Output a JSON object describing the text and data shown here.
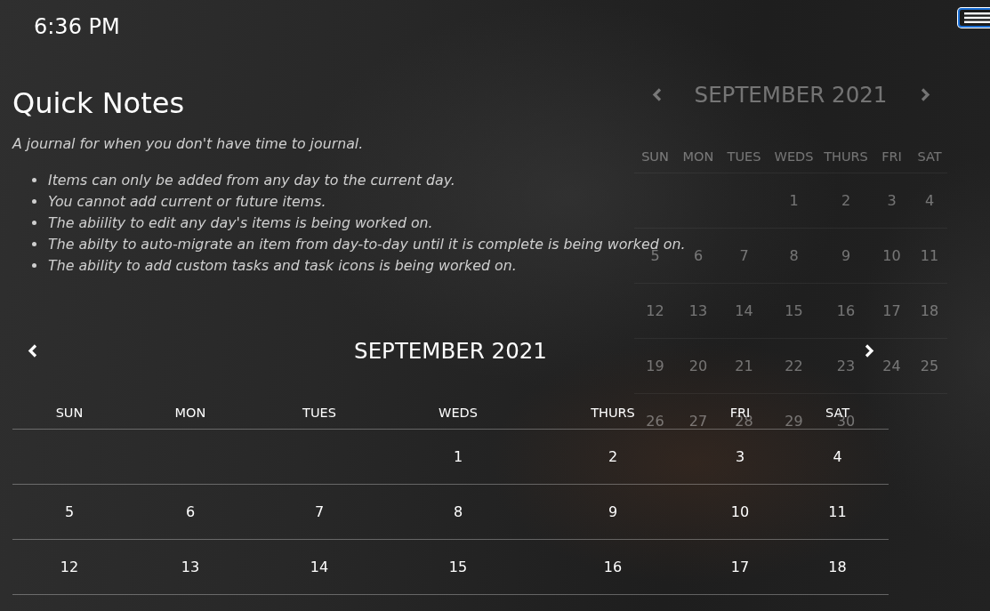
{
  "clock": {
    "time": "6:36 PM"
  },
  "menu_button": {
    "focused": true
  },
  "intro": {
    "title": "Quick Notes",
    "subtitle": "A journal for when you don't have time to journal.",
    "notes": [
      "Items can only be added from any day to the current day.",
      "You cannot add current or future items.",
      "The abiility to edit any day's items is being worked on.",
      "The abilty to auto-migrate an item from day-to-day until it is complete is being worked on.",
      "The ability to add custom tasks and task icons is being worked on."
    ]
  },
  "background_calendar": {
    "title": "SEPTEMBER 2021",
    "weekdays": [
      "SUN",
      "MON",
      "TUES",
      "WEDS",
      "THURS",
      "FRI",
      "SAT"
    ],
    "weeks": [
      [
        "1",
        "2",
        "3",
        "4"
      ],
      [
        "5",
        "6",
        "7",
        "8",
        "9",
        "10",
        "11"
      ],
      [
        "12",
        "13",
        "14",
        "15",
        "16",
        "17",
        "18"
      ],
      [
        "19",
        "20",
        "21",
        "22",
        "23",
        "24",
        "25"
      ],
      [
        "26",
        "27",
        "28",
        "29",
        "30"
      ]
    ]
  },
  "calendar": {
    "title": "SEPTEMBER 2021",
    "weekdays": [
      "SUN",
      "MON",
      "TUES",
      "WEDS",
      "THURS",
      "FRI",
      "SAT"
    ],
    "weeks": [
      [
        "1",
        "2",
        "3",
        "4"
      ],
      [
        "5",
        "6",
        "7",
        "8",
        "9",
        "10",
        "11"
      ],
      [
        "12",
        "13",
        "14",
        "15",
        "16",
        "17",
        "18"
      ]
    ]
  }
}
